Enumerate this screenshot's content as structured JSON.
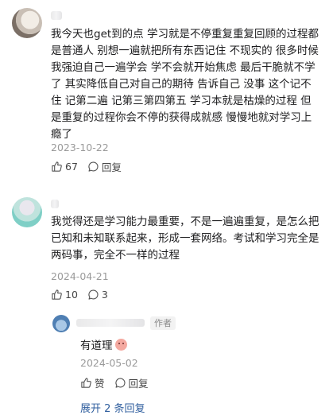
{
  "comments": [
    {
      "text": "我今天也get到的点 学习就是不停重复重复回顾的过程都是普通人 别想一遍就把所有东西记住 不现实的 很多时候我强迫自己一遍学会 学不会就开始焦虑 最后干脆就不学了 其实降低自己对自己的期待 告诉自己 没事 这个记不住 记第二遍 记第三第四第五 学习本就是枯燥的过程 但是重复的过程你会不停的获得成就感 慢慢地就对学习上瘾了",
      "date": "2023-10-22",
      "likes": "67",
      "reply_label": "回复"
    },
    {
      "text": "我觉得还是学习能力最重要，不是一遍遍重复，是怎么把已知和未知联系起来，形成一套网络。考试和学习完全是两码事，完全不一样的过程",
      "date": "2024-04-21",
      "likes": "10",
      "replies": "3"
    }
  ],
  "reply": {
    "badge": "作者",
    "text": "有道理",
    "date": "2024-05-02",
    "like_label": "赞",
    "reply_label": "回复"
  },
  "expand_label": "展开 2 条回复"
}
